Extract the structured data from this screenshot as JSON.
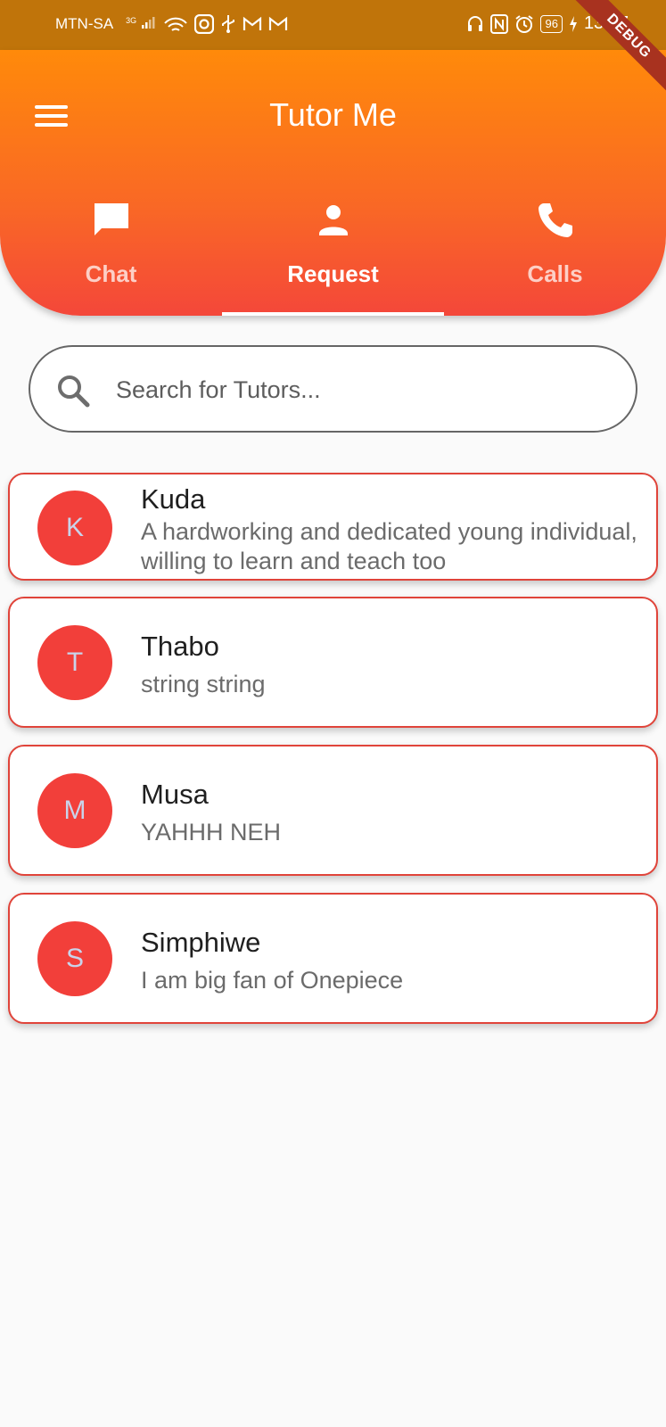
{
  "status_bar": {
    "carrier": "MTN-SA",
    "network": "3G",
    "battery": "96",
    "time": "13:47"
  },
  "debug_ribbon": "DEBUG",
  "app": {
    "title": "Tutor Me"
  },
  "tabs": [
    {
      "label": "Chat",
      "icon": "chat-icon",
      "active": false
    },
    {
      "label": "Request",
      "icon": "person-icon",
      "active": true
    },
    {
      "label": "Calls",
      "icon": "phone-icon",
      "active": false
    }
  ],
  "search": {
    "placeholder": "Search for Tutors...",
    "value": ""
  },
  "tutors": [
    {
      "initial": "K",
      "name": "Kuda",
      "description": "A hardworking and dedicated young individual, willing to learn and teach too"
    },
    {
      "initial": "T",
      "name": "Thabo",
      "description": "string string"
    },
    {
      "initial": "M",
      "name": "Musa",
      "description": "YAHHH NEH"
    },
    {
      "initial": "S",
      "name": "Simphiwe",
      "description": "I am big fan of Onepiece"
    }
  ],
  "colors": {
    "header_top": "#ff8a0a",
    "header_bottom": "#f4473a",
    "avatar": "#f23f3a",
    "card_border": "#e0443a"
  }
}
